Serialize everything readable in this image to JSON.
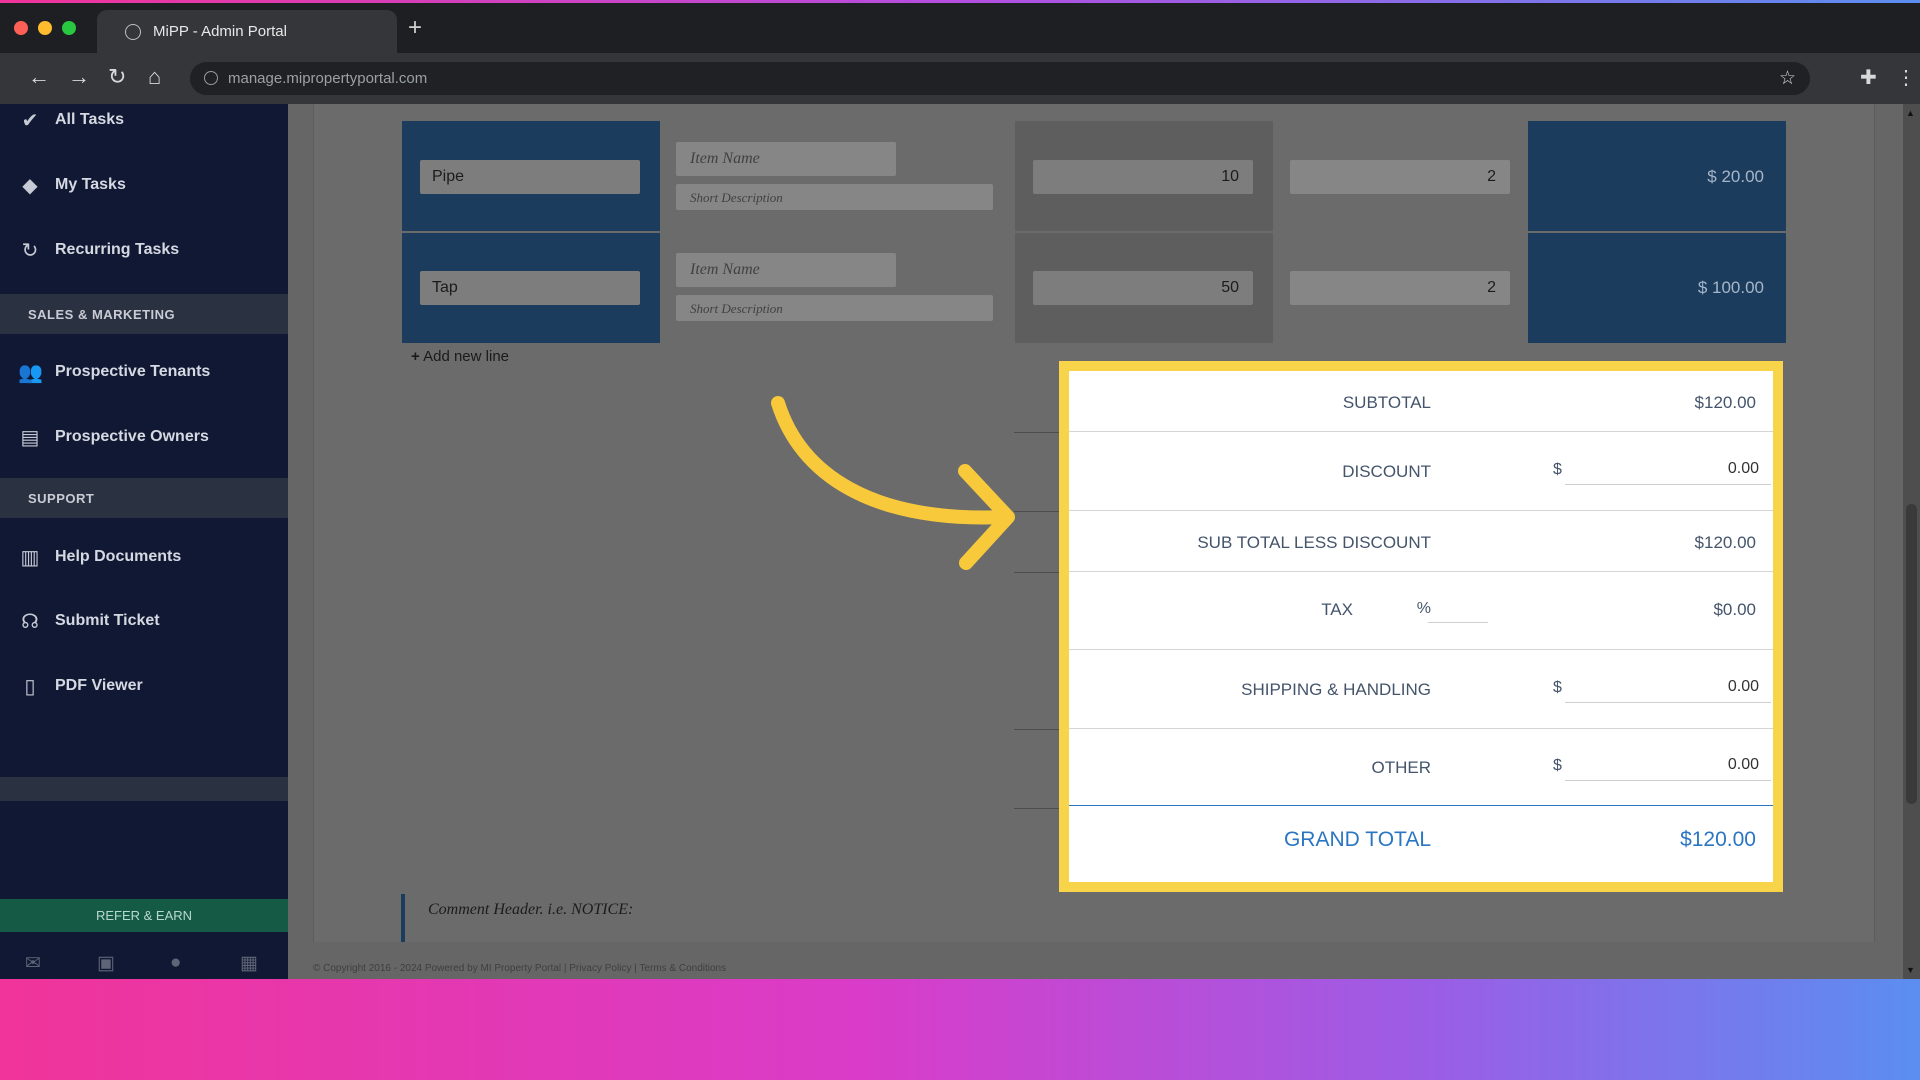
{
  "browser": {
    "tab_title": "MiPP - Admin Portal",
    "new_tab": "+",
    "url": "manage.mipropertyportal.com"
  },
  "sidebar": {
    "items_top": [
      {
        "label": "All Tasks",
        "icon": "check-icon"
      },
      {
        "label": "My Tasks",
        "icon": "tag-icon"
      },
      {
        "label": "Recurring Tasks",
        "icon": "refresh-icon"
      }
    ],
    "section_sales": "SALES & MARKETING",
    "items_sales": [
      {
        "label": "Prospective Tenants",
        "icon": "users-icon"
      },
      {
        "label": "Prospective Owners",
        "icon": "id-card-icon"
      }
    ],
    "section_support": "SUPPORT",
    "items_support": [
      {
        "label": "Help Documents",
        "icon": "book-icon"
      },
      {
        "label": "Submit Ticket",
        "icon": "headset-icon"
      },
      {
        "label": "PDF Viewer",
        "icon": "pdf-icon"
      }
    ],
    "refer": "REFER & EARN"
  },
  "lines": [
    {
      "item": "Pipe",
      "name_placeholder": "Item Name",
      "desc_placeholder": "Short Description",
      "rate": "10",
      "qty": "2",
      "amount": "$ 20.00"
    },
    {
      "item": "Tap",
      "name_placeholder": "Item Name",
      "desc_placeholder": "Short Description",
      "rate": "50",
      "qty": "2",
      "amount": "$ 100.00"
    }
  ],
  "add_line": "Add new line",
  "totals": {
    "subtotal_label": "SUBTOTAL",
    "subtotal_value": "$120.00",
    "discount_label": "DISCOUNT",
    "discount_currency": "$",
    "discount_value": "0.00",
    "sub_less_label": "SUB TOTAL LESS DISCOUNT",
    "sub_less_value": "$120.00",
    "tax_label": "TAX",
    "tax_percent": "%",
    "tax_value": "$0.00",
    "shipping_label": "SHIPPING & HANDLING",
    "shipping_currency": "$",
    "shipping_value": "0.00",
    "other_label": "OTHER",
    "other_currency": "$",
    "other_value": "0.00",
    "grand_label": "GRAND TOTAL",
    "grand_value": "$120.00"
  },
  "comment_header": "Comment Header. i.e. NOTICE:",
  "footer": "© Copyright 2016 - 2024 Powered by MI Property Portal | Privacy Policy | Terms & Conditions",
  "colors": {
    "highlight": "#f8d44a",
    "sidebar": "#111833",
    "grand_total": "#2a76c2"
  }
}
